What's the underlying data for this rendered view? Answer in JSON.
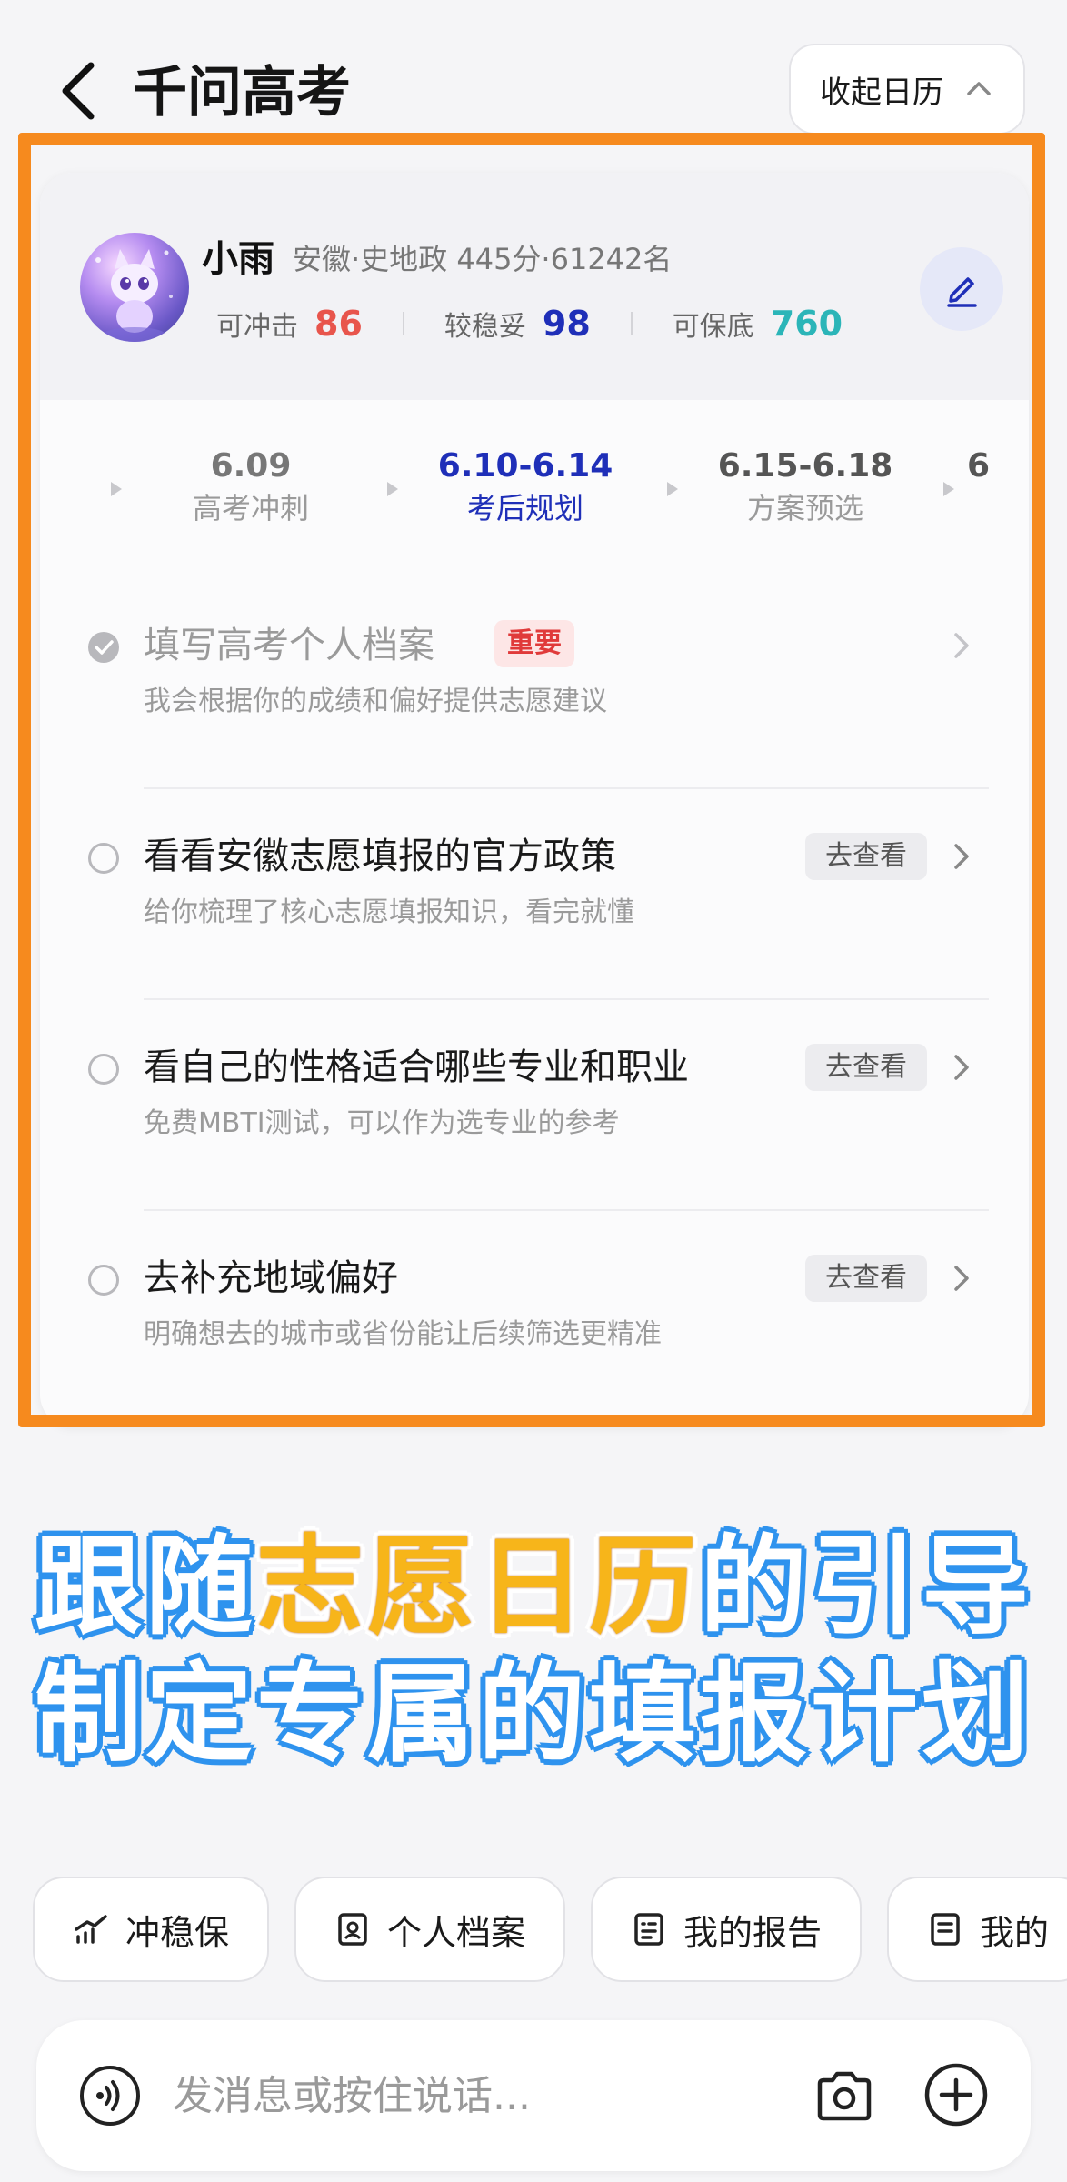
{
  "header": {
    "title": "千问高考",
    "collapse_label": "收起日历"
  },
  "profile": {
    "name": "小雨",
    "info": "安徽·史地政 445分·61242名",
    "stats": [
      {
        "label": "可冲击",
        "value": "86",
        "color": "#e8554c"
      },
      {
        "label": "较稳妥",
        "value": "98",
        "color": "#1f2fb8"
      },
      {
        "label": "可保底",
        "value": "760",
        "color": "#2bb5b8"
      }
    ]
  },
  "timeline": [
    {
      "date": "6.09",
      "label": "高考冲刺",
      "state": "past"
    },
    {
      "date": "6.10-6.14",
      "label": "考后规划",
      "state": "active"
    },
    {
      "date": "6.15-6.18",
      "label": "方案预选",
      "state": "future"
    },
    {
      "date": "6",
      "label": "",
      "state": "future"
    }
  ],
  "tasks": [
    {
      "title": "填写高考个人档案",
      "subtitle": "我会根据你的成绩和偏好提供志愿建议",
      "badge": "重要",
      "done": true
    },
    {
      "title": "看看安徽志愿填报的官方政策",
      "subtitle": "给你梳理了核心志愿填报知识，看完就懂",
      "action": "去查看",
      "done": false
    },
    {
      "title": "看自己的性格适合哪些专业和职业",
      "subtitle": "免费MBTI测试，可以作为选专业的参考",
      "action": "去查看",
      "done": false
    },
    {
      "title": "去补充地域偏好",
      "subtitle": "明确想去的城市或省份能让后续筛选更精准",
      "action": "去查看",
      "done": false
    }
  ],
  "caption": {
    "line1_a": "跟随",
    "line1_hl": "志愿日历",
    "line1_b": "的引导",
    "line2": "制定专属的填报计划"
  },
  "quick_actions": [
    {
      "label": "冲稳保",
      "icon": "trend-icon"
    },
    {
      "label": "个人档案",
      "icon": "profile-card-icon"
    },
    {
      "label": "我的报告",
      "icon": "report-icon"
    },
    {
      "label": "我的",
      "icon": "list-icon"
    }
  ],
  "input": {
    "placeholder": "发消息或按住说话..."
  }
}
